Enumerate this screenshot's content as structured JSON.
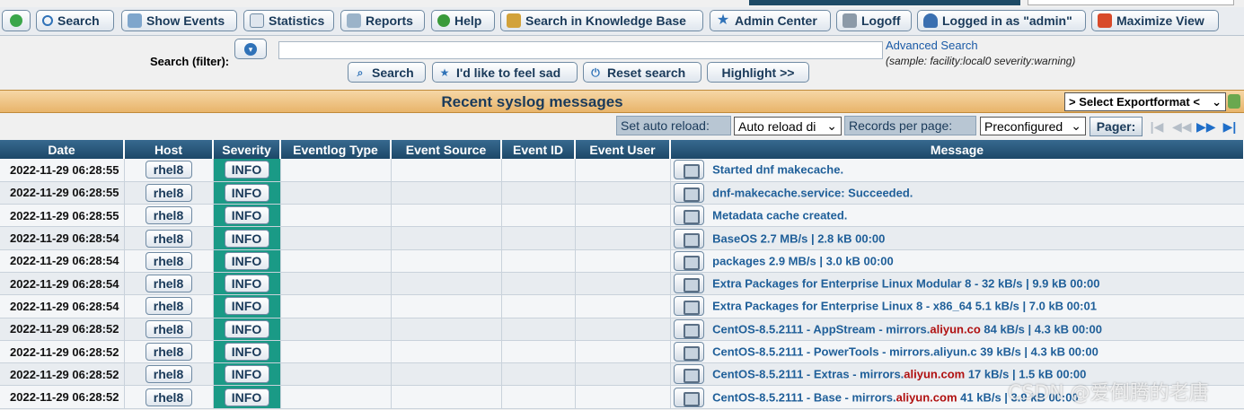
{
  "toolbar": {
    "search": "Search",
    "show_events": "Show Events",
    "statistics": "Statistics",
    "reports": "Reports",
    "help": "Help",
    "knowledge_base": "Search in Knowledge Base",
    "admin_center": "Admin Center",
    "logoff": "Logoff",
    "logged_in": "Logged in as \"admin\"",
    "maximize": "Maximize View"
  },
  "search": {
    "label": "Search (filter):",
    "value": "",
    "advanced_link": "Advanced Search",
    "sample": "(sample: facility:local0 severity:warning)",
    "search_btn": "Search",
    "feel_sad_btn": "I'd like to feel sad",
    "reset_btn": "Reset search",
    "highlight_btn": "Highlight >>"
  },
  "title": "Recent syslog messages",
  "export": {
    "selected": "> Select Exportformat <"
  },
  "pager": {
    "auto_reload_label": "Set auto reload:",
    "auto_reload_value": "Auto reload di",
    "records_label": "Records per page:",
    "records_value": "Preconfigured",
    "pager_label": "Pager:"
  },
  "columns": [
    "Date",
    "Host",
    "Severity",
    "Eventlog Type",
    "Event Source",
    "Event ID",
    "Event User",
    "Message"
  ],
  "rows": [
    {
      "date": "2022-11-29 06:28:55",
      "host": "rhel8",
      "severity": "INFO",
      "msg_a": "Started dnf makecache.",
      "msg_hl": "",
      "msg_b": ""
    },
    {
      "date": "2022-11-29 06:28:55",
      "host": "rhel8",
      "severity": "INFO",
      "msg_a": "dnf-makecache.service: Succeeded.",
      "msg_hl": "",
      "msg_b": ""
    },
    {
      "date": "2022-11-29 06:28:55",
      "host": "rhel8",
      "severity": "INFO",
      "msg_a": "Metadata cache created.",
      "msg_hl": "",
      "msg_b": ""
    },
    {
      "date": "2022-11-29 06:28:54",
      "host": "rhel8",
      "severity": "INFO",
      "msg_a": "BaseOS 2.7 MB/s | 2.8 kB 00:00",
      "msg_hl": "",
      "msg_b": ""
    },
    {
      "date": "2022-11-29 06:28:54",
      "host": "rhel8",
      "severity": "INFO",
      "msg_a": "packages 2.9 MB/s | 3.0 kB 00:00",
      "msg_hl": "",
      "msg_b": ""
    },
    {
      "date": "2022-11-29 06:28:54",
      "host": "rhel8",
      "severity": "INFO",
      "msg_a": "Extra Packages for Enterprise Linux Modular 8 - 32 kB/s | 9.9 kB 00:00",
      "msg_hl": "",
      "msg_b": ""
    },
    {
      "date": "2022-11-29 06:28:54",
      "host": "rhel8",
      "severity": "INFO",
      "msg_a": "Extra Packages for Enterprise Linux 8 - x86_64 5.1 kB/s | 7.0 kB 00:01",
      "msg_hl": "",
      "msg_b": ""
    },
    {
      "date": "2022-11-29 06:28:52",
      "host": "rhel8",
      "severity": "INFO",
      "msg_a": "CentOS-8.5.2111 - AppStream - mirrors.",
      "msg_hl": "aliyun.co",
      "msg_b": " 84 kB/s | 4.3 kB 00:00"
    },
    {
      "date": "2022-11-29 06:28:52",
      "host": "rhel8",
      "severity": "INFO",
      "msg_a": "CentOS-8.5.2111 - PowerTools - mirrors.aliyun.c 39 kB/s | 4.3 kB 00:00",
      "msg_hl": "",
      "msg_b": ""
    },
    {
      "date": "2022-11-29 06:28:52",
      "host": "rhel8",
      "severity": "INFO",
      "msg_a": "CentOS-8.5.2111 - Extras - mirrors.",
      "msg_hl": "aliyun.com",
      "msg_b": " 17 kB/s | 1.5 kB 00:00"
    },
    {
      "date": "2022-11-29 06:28:52",
      "host": "rhel8",
      "severity": "INFO",
      "msg_a": "CentOS-8.5.2111 - Base - mirrors.",
      "msg_hl": "aliyun.com",
      "msg_b": " 41 kB/s | 3.9 kB 00:00"
    }
  ],
  "watermark": "CSDN @爱倒腾的老唐"
}
